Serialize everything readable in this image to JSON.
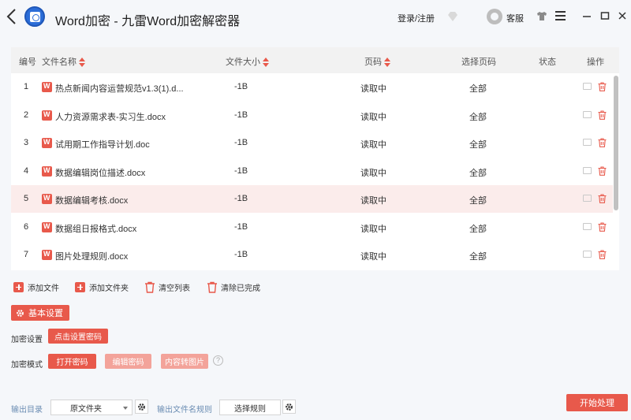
{
  "window": {
    "title": "Word加密 - 九雷Word加密解密器",
    "login_label": "登录/注册",
    "service_label": "客服",
    "accent_color": "#e8594b"
  },
  "table": {
    "headers": {
      "index": "编号",
      "name": "文件名称",
      "size": "文件大小",
      "pages": "页码",
      "select_pages": "选择页码",
      "status": "状态",
      "actions": "操作"
    },
    "rows": [
      {
        "index": "1",
        "name": "热点新闻内容运营规范v1.3(1).d...",
        "size": "-1B",
        "pages": "读取中",
        "select_pages": "全部",
        "status": ""
      },
      {
        "index": "2",
        "name": "人力资源需求表-实习生.docx",
        "size": "-1B",
        "pages": "读取中",
        "select_pages": "全部",
        "status": ""
      },
      {
        "index": "3",
        "name": "试用期工作指导计划.doc",
        "size": "-1B",
        "pages": "读取中",
        "select_pages": "全部",
        "status": ""
      },
      {
        "index": "4",
        "name": "数据编辑岗位描述.docx",
        "size": "-1B",
        "pages": "读取中",
        "select_pages": "全部",
        "status": ""
      },
      {
        "index": "5",
        "name": "数据编辑考核.docx",
        "size": "-1B",
        "pages": "读取中",
        "select_pages": "全部",
        "status": "",
        "selected": true
      },
      {
        "index": "6",
        "name": "数据组日报格式.docx",
        "size": "-1B",
        "pages": "读取中",
        "select_pages": "全部",
        "status": ""
      },
      {
        "index": "7",
        "name": "图片处理规则.docx",
        "size": "-1B",
        "pages": "读取中",
        "select_pages": "全部",
        "status": ""
      }
    ]
  },
  "toolbar": {
    "add_file": "添加文件",
    "add_folder": "添加文件夹",
    "clear_list": "清空列表",
    "clear_done": "清除已完成"
  },
  "settings": {
    "basic_label": "基本设置",
    "encrypt_setting_label": "加密设置",
    "set_password_button": "点击设置密码",
    "encrypt_mode_label": "加密模式",
    "modes": [
      "打开密码",
      "编辑密码",
      "内容转图片"
    ],
    "help_symbol": "?"
  },
  "output": {
    "dir_label": "输出目录",
    "dir_value": "原文件夹",
    "name_rule_label": "输出文件名规则",
    "rule_button": "选择规则",
    "start_button": "开始处理"
  }
}
